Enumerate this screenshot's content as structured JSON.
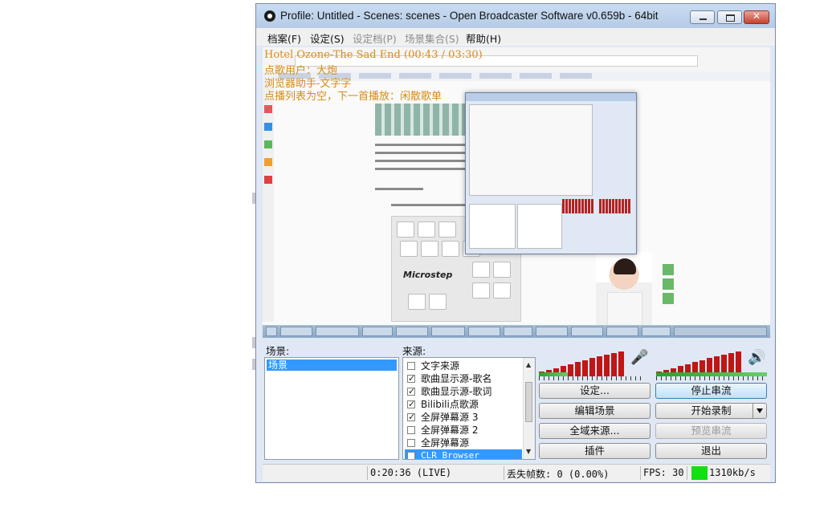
{
  "window": {
    "title": "Profile: Untitled - Scenes: scenes - Open Broadcaster Software v0.659b - 64bit",
    "close_glyph": "✕"
  },
  "menu": [
    {
      "label": "档案(F)",
      "enabled": true
    },
    {
      "label": "设定(S)",
      "enabled": true
    },
    {
      "label": "设定档(P)",
      "enabled": false
    },
    {
      "label": "场景集合(S)",
      "enabled": false
    },
    {
      "label": "帮助(H)",
      "enabled": true
    }
  ],
  "overlay": {
    "line1": "Hotel Ozone-The Sad End (00:43 / 03:30)",
    "line2": "点歌用户：大炮",
    "line3": "浏览器助手-文字字",
    "line4": "点播列表为空，下一首播放：闲散歌单"
  },
  "preview_page": {
    "keyboard_brand": "Microstep"
  },
  "scenes": {
    "label": "场景:",
    "items": [
      "场景"
    ]
  },
  "sources": {
    "label": "来源:",
    "items": [
      {
        "name": "文字来源",
        "checked": false
      },
      {
        "name": "歌曲显示源-歌名",
        "checked": true
      },
      {
        "name": "歌曲显示源-歌词",
        "checked": true
      },
      {
        "name": "Bilibili点歌源",
        "checked": true
      },
      {
        "name": "全屏弹幕源 3",
        "checked": true
      },
      {
        "name": "全屏弹幕源 2",
        "checked": false
      },
      {
        "name": "全屏弹幕源",
        "checked": false
      },
      {
        "name": "CLR Browser",
        "checked": false
      }
    ]
  },
  "buttons": {
    "settings": "设定...",
    "stop_stream": "停止串流",
    "edit_scene": "编辑场景",
    "start_record": "开始录制",
    "global_sources": "全域来源...",
    "preview_stream": "预览串流",
    "plugins": "插件",
    "exit": "退出"
  },
  "status": {
    "time": "0:20:36 (LIVE)",
    "dropped_frames": "丢失帧数: 0 (0.00%)",
    "fps": "FPS: 30",
    "bitrate": "1310kb/s",
    "indicator_color": "#11e011"
  },
  "colors": {
    "meter_red": "#c01616",
    "selection_blue": "#3399ff",
    "overlay_orange": "#d88a16"
  }
}
